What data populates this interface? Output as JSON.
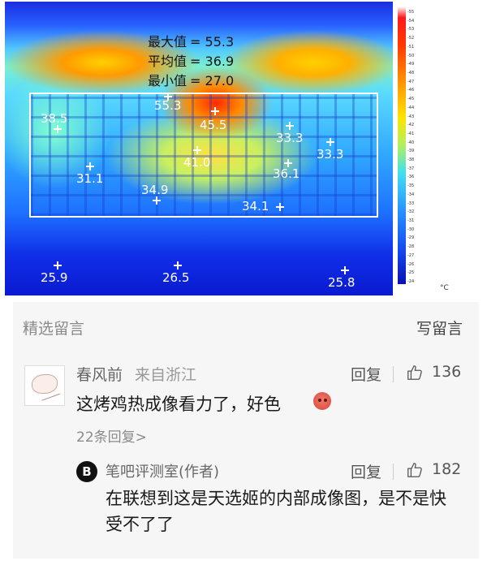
{
  "thermal": {
    "stats": {
      "max_label": "最大值",
      "max_value": "= 55.3",
      "avg_label": "平均值",
      "avg_value": "= 36.9",
      "min_label": "最小值",
      "min_value": "= 27.0"
    },
    "points": [
      "38.5",
      "55.3",
      "45.5",
      "33.3",
      "33.3",
      "31.1",
      "41.0",
      "36.1",
      "34.9",
      "34.1",
      "25.9",
      "26.5",
      "25.8"
    ],
    "scale_ticks": [
      "55",
      "54",
      "53",
      "52",
      "51",
      "50",
      "49",
      "48",
      "47",
      "46",
      "45",
      "44",
      "43",
      "42",
      "41",
      "40",
      "39",
      "38",
      "37",
      "36",
      "35",
      "34",
      "33",
      "32",
      "31",
      "30",
      "29",
      "28",
      "27",
      "26",
      "25",
      "24"
    ],
    "unit": "°C"
  },
  "comments_panel": {
    "section_title": "精选留言",
    "write_comment": "写留言",
    "comments": [
      {
        "author": "春风前",
        "location": "来自浙江",
        "reply_label": "回复",
        "likes": "136",
        "text": "这烤鸡热成像看力了，好色",
        "replies_link": "22条回复>",
        "emoji": "blush-emoji"
      },
      {
        "author": "笔吧评测室(作者)",
        "reply_label": "回复",
        "likes": "182",
        "text": "在联想到这是天选姬的内部成像图，是不是快受不了了",
        "logo_letter": "B"
      }
    ]
  }
}
